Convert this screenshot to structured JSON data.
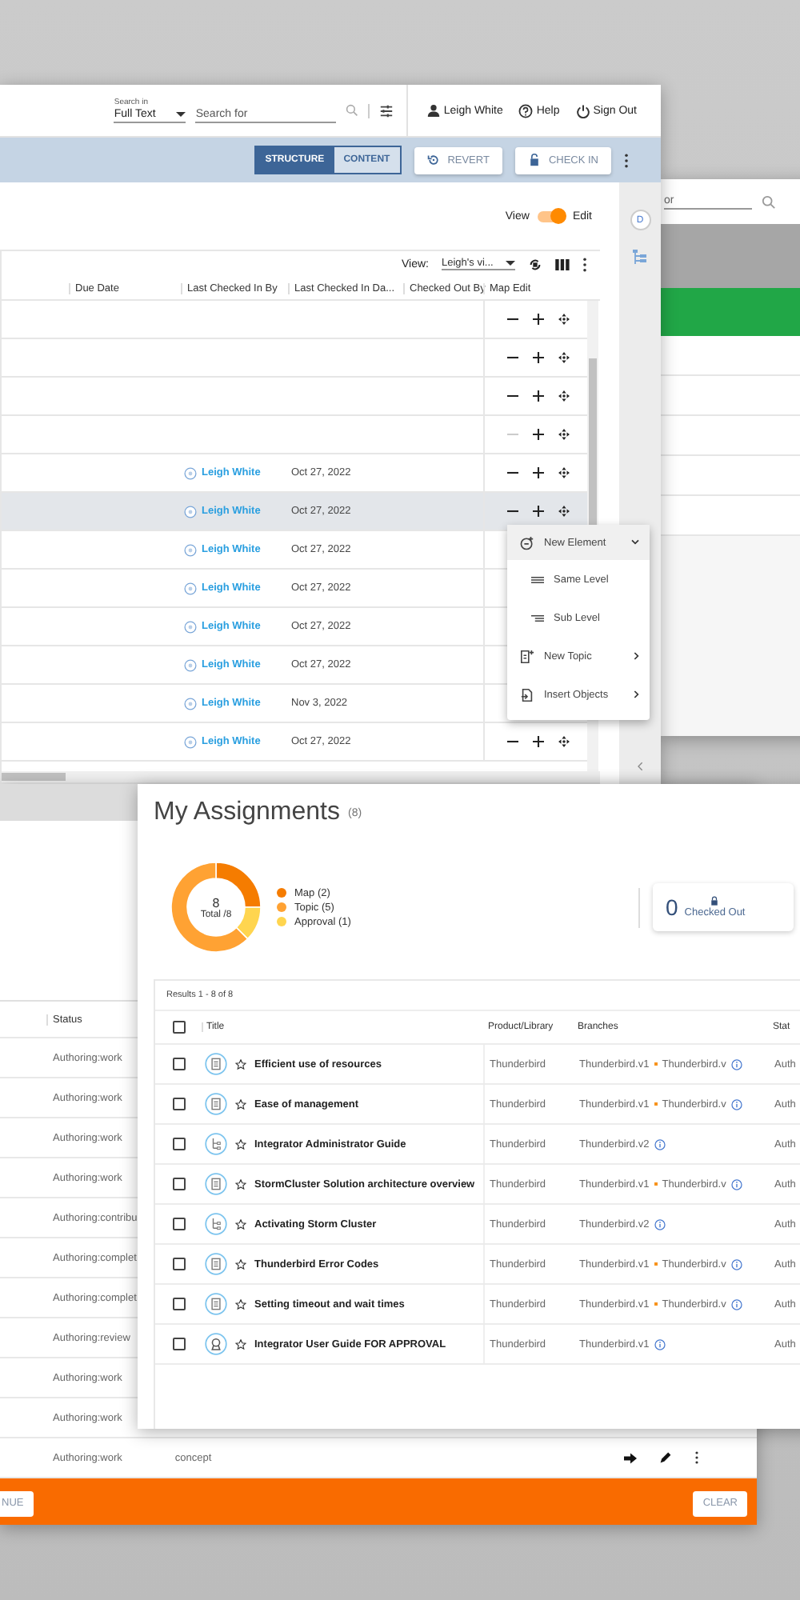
{
  "editor_window": {
    "header": {
      "search_in_label": "Search in",
      "search_in_value": "Full Text",
      "search_placeholder": "Search for",
      "user": "Leigh White",
      "help": "Help",
      "sign_out": "Sign Out"
    },
    "toolbar": {
      "view_tabs": [
        {
          "label": "STRUCTURE",
          "selected": true
        },
        {
          "label": "CONTENT",
          "selected": false
        }
      ],
      "revert": "REVERT",
      "check_in": "CHECK IN"
    },
    "mode_toggle": {
      "left_label": "View",
      "right_label": "Edit",
      "on": true
    },
    "table": {
      "view_label": "View:",
      "view_value": "Leigh's vi...",
      "columns": [
        "Due Date",
        "Last Checked In By",
        "Last Checked In Da...",
        "Checked Out By",
        "Map Edit"
      ],
      "rows": [
        {
          "selected": false,
          "remove_disabled": false
        },
        {
          "selected": false,
          "remove_disabled": false
        },
        {
          "selected": false,
          "remove_disabled": false
        },
        {
          "selected": false,
          "remove_disabled": true
        },
        {
          "checked_in_by": "Leigh White",
          "checked_in_date": "Oct 27, 2022",
          "selected": false,
          "remove_disabled": false
        },
        {
          "checked_in_by": "Leigh White",
          "checked_in_date": "Oct 27, 2022",
          "selected": true,
          "remove_disabled": false
        },
        {
          "checked_in_by": "Leigh White",
          "checked_in_date": "Oct 27, 2022",
          "selected": false
        },
        {
          "checked_in_by": "Leigh White",
          "checked_in_date": "Oct 27, 2022",
          "selected": false
        },
        {
          "checked_in_by": "Leigh White",
          "checked_in_date": "Oct 27, 2022",
          "selected": false
        },
        {
          "checked_in_by": "Leigh White",
          "checked_in_date": "Oct 27, 2022",
          "selected": false
        },
        {
          "checked_in_by": "Leigh White",
          "checked_in_date": "Nov 3, 2022",
          "selected": false
        },
        {
          "checked_in_by": "Leigh White",
          "checked_in_date": "Oct 27, 2022",
          "selected": false,
          "remove_disabled": false
        }
      ]
    },
    "context_menu": [
      {
        "kind": "group",
        "label": "New Element",
        "selected": true
      },
      {
        "kind": "option",
        "label": "Same Level",
        "selected": false
      },
      {
        "kind": "option",
        "label": "Sub Level",
        "selected": false
      },
      {
        "kind": "submenu",
        "label": "New Topic",
        "selected": false
      },
      {
        "kind": "submenu",
        "label": "Insert Objects",
        "selected": false
      }
    ],
    "side_panel": {
      "badge": "D"
    }
  },
  "back_window": {
    "search_value": "or"
  },
  "status_window": {
    "column": "Status",
    "rows": [
      {
        "status": "Authoring:work"
      },
      {
        "status": "Authoring:work"
      },
      {
        "status": "Authoring:work"
      },
      {
        "status": "Authoring:work"
      },
      {
        "status": "Authoring:contribu"
      },
      {
        "status": "Authoring:complet"
      },
      {
        "status": "Authoring:complet"
      },
      {
        "status": "Authoring:review"
      },
      {
        "status": "Authoring:work"
      },
      {
        "status": "Authoring:work"
      },
      {
        "status": "Authoring:work",
        "type": "concept"
      }
    ],
    "continue_button": "NUE",
    "clear_button": "CLEAR"
  },
  "assignments": {
    "title": "My Assignments",
    "count": "(8)",
    "chart_data": {
      "type": "donut",
      "categories": [
        "Map (2)",
        "Topic (5)",
        "Approval (1)"
      ],
      "values": [
        2,
        5,
        1
      ],
      "colors": [
        "#f57c00",
        "#ffa233",
        "#ffd54f"
      ]
    },
    "total": "8",
    "total_label": "Total /8",
    "checked_out": {
      "count": "0",
      "label": "Checked Out"
    },
    "results": "Results 1 - 8 of 8",
    "select_all_checked": false,
    "columns": [
      "Title",
      "Product/Library",
      "Branches",
      "Stat"
    ],
    "rows": [
      {
        "kind": "topic",
        "title": "Efficient use of resources",
        "starred": false,
        "checked": false,
        "product": "Thunderbird",
        "branches": [
          "Thunderbird.v1",
          "Thunderbird.v"
        ],
        "status": "Auth"
      },
      {
        "kind": "topic",
        "title": "Ease of management",
        "starred": false,
        "checked": false,
        "product": "Thunderbird",
        "branches": [
          "Thunderbird.v1",
          "Thunderbird.v"
        ],
        "status": "Auth"
      },
      {
        "kind": "map",
        "title": "Integrator Administrator Guide",
        "starred": false,
        "checked": false,
        "product": "Thunderbird",
        "branches": [
          "Thunderbird.v2"
        ],
        "status": "Auth"
      },
      {
        "kind": "topic",
        "title": "StormCluster Solution architecture overview",
        "starred": false,
        "checked": false,
        "product": "Thunderbird",
        "branches": [
          "Thunderbird.v1",
          "Thunderbird.v"
        ],
        "status": "Auth"
      },
      {
        "kind": "map",
        "title": "Activating Storm Cluster",
        "starred": false,
        "checked": false,
        "product": "Thunderbird",
        "branches": [
          "Thunderbird.v2"
        ],
        "status": "Auth"
      },
      {
        "kind": "topic",
        "title": "Thunderbird Error Codes",
        "starred": false,
        "checked": false,
        "product": "Thunderbird",
        "branches": [
          "Thunderbird.v1",
          "Thunderbird.v"
        ],
        "status": "Auth"
      },
      {
        "kind": "topic",
        "title": "Setting timeout and wait times",
        "starred": false,
        "checked": false,
        "product": "Thunderbird",
        "branches": [
          "Thunderbird.v1",
          "Thunderbird.v"
        ],
        "status": "Auth"
      },
      {
        "kind": "approval",
        "title": "Integrator User Guide FOR APPROVAL",
        "starred": false,
        "checked": false,
        "product": "Thunderbird",
        "branches": [
          "Thunderbird.v1"
        ],
        "status": "Auth"
      }
    ]
  }
}
